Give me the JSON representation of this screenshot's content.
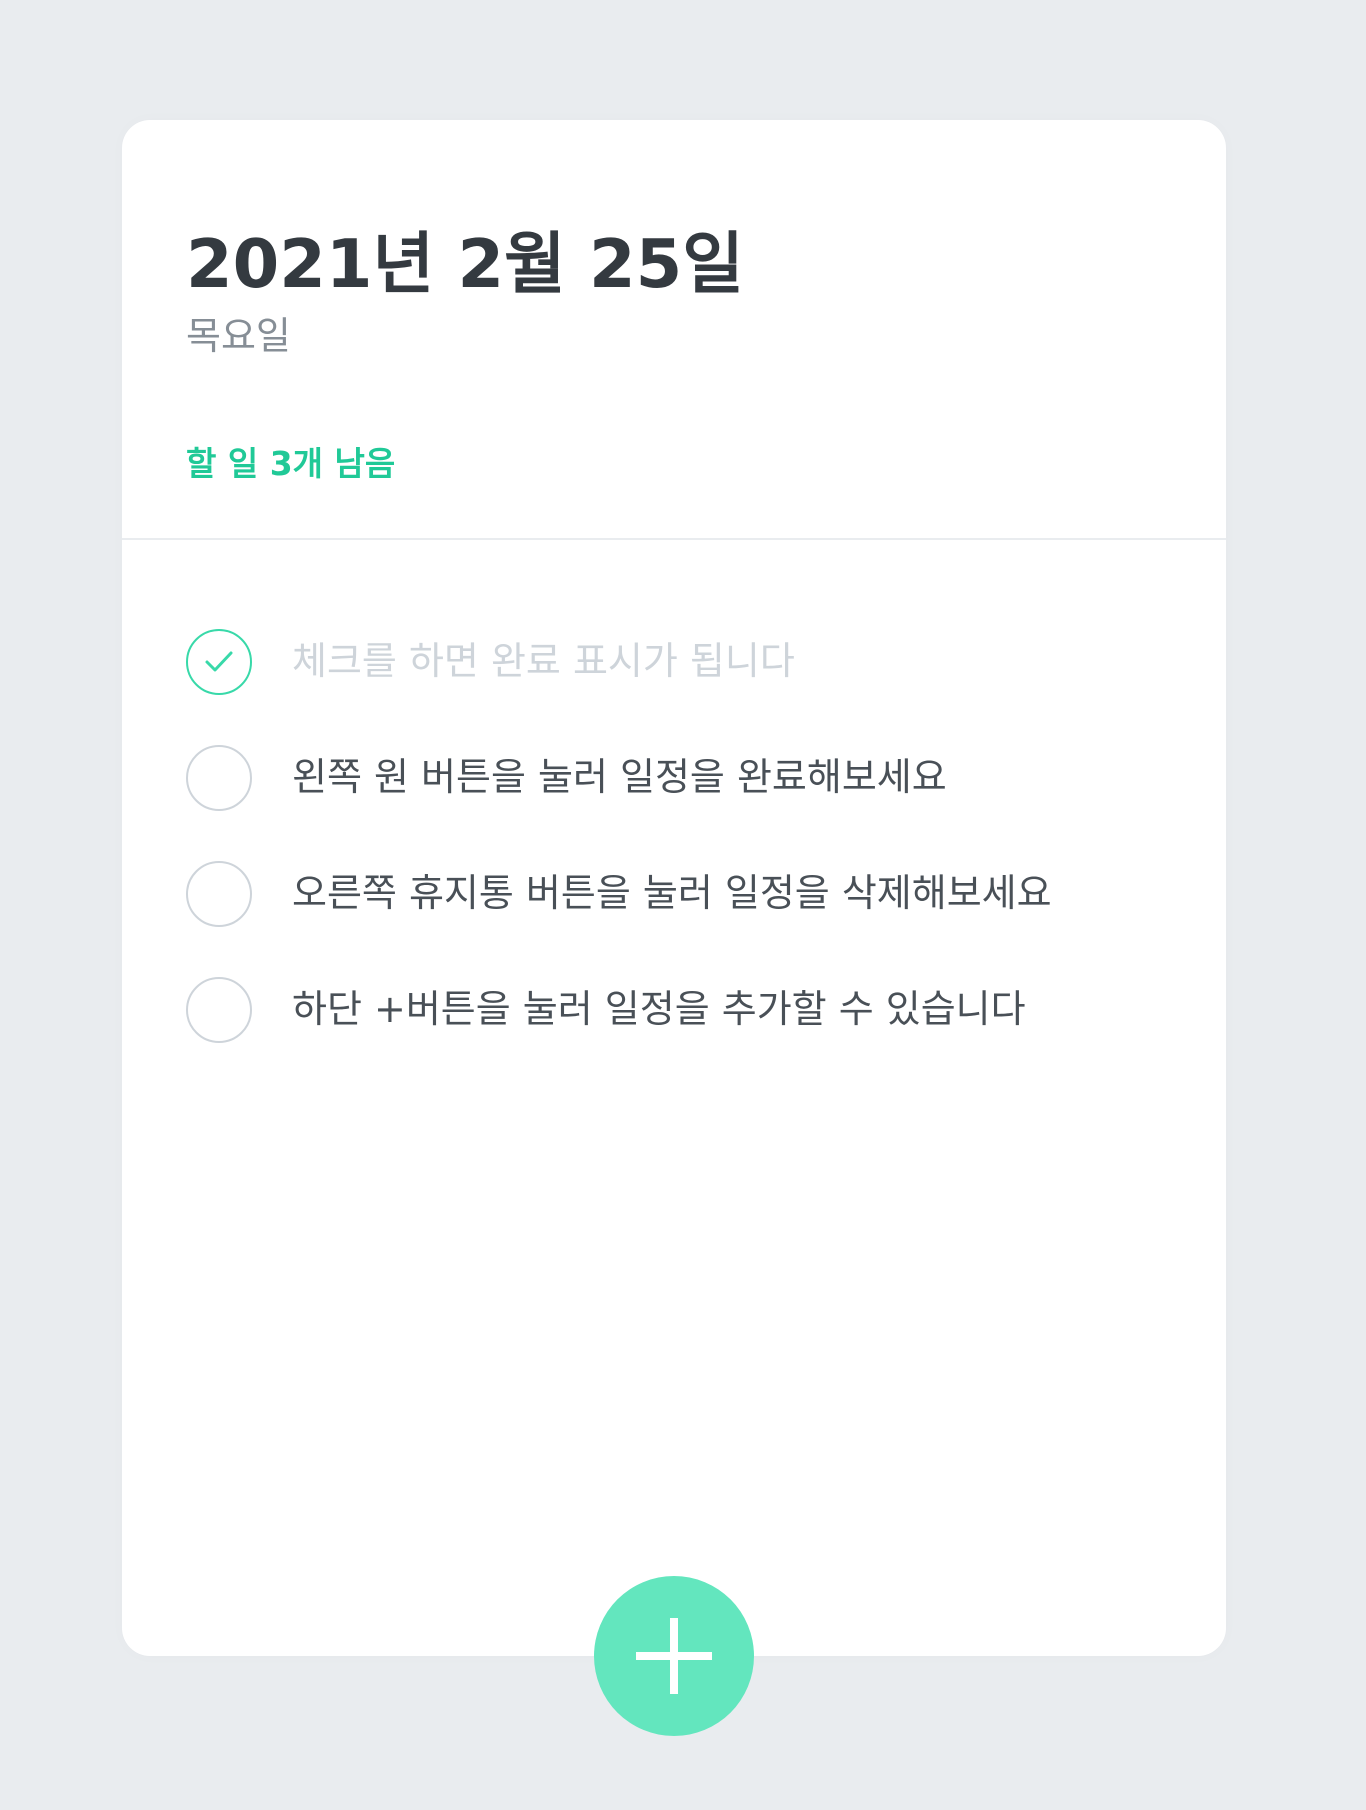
{
  "header": {
    "date": "2021년 2월 25일",
    "weekday": "목요일",
    "tasks_left": "할 일 3개 남음"
  },
  "todos": [
    {
      "text": "체크를 하면 완료 표시가 됩니다",
      "done": true
    },
    {
      "text": "왼쪽 원 버튼을 눌러 일정을 완료해보세요",
      "done": false
    },
    {
      "text": "오른쪽 휴지통 버튼을 눌러 일정을 삭제해보세요",
      "done": false
    },
    {
      "text": "하단 +버튼을 눌러 일정을 추가할 수 있습니다",
      "done": false
    }
  ],
  "add_button": {
    "icon": "plus-icon"
  },
  "colors": {
    "background": "#e9ecef",
    "card": "#ffffff",
    "accent": "#20c997",
    "check_done": "#38d9a9",
    "add_button": "#63e6be",
    "text": "#495057",
    "done_text": "#ced4da"
  }
}
